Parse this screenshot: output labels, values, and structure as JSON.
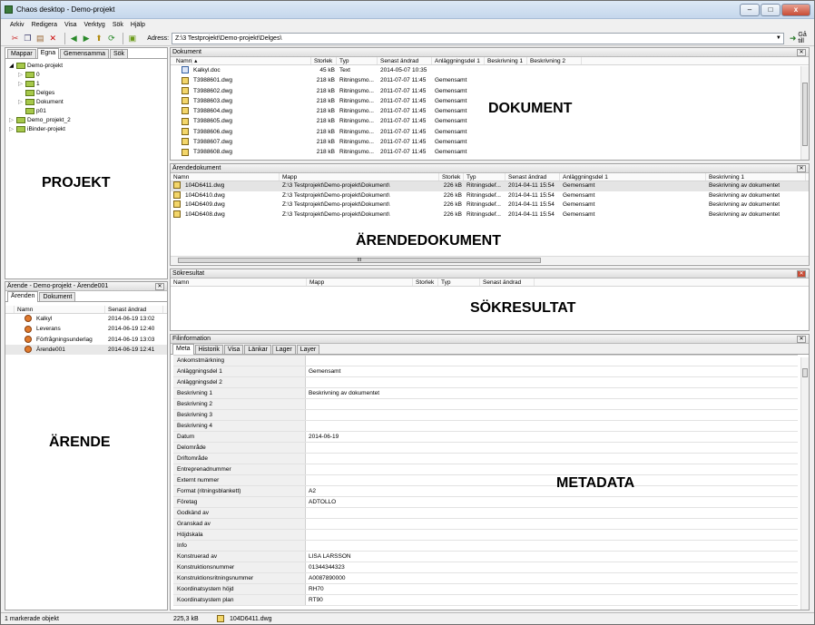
{
  "window": {
    "title": "Chaos desktop - Demo-projekt",
    "min": "–",
    "max": "□",
    "close": "x"
  },
  "menu": [
    "Arkiv",
    "Redigera",
    "Visa",
    "Verktyg",
    "Sök",
    "Hjälp"
  ],
  "toolbar": {
    "address_label": "Adress:",
    "address_value": "Z:\\3 Testprojekt\\Demo-projekt\\Delges\\",
    "goto_label": "Gå till"
  },
  "projects": {
    "tabs": [
      "Mappar",
      "Egna",
      "Gemensamma",
      "Sök"
    ],
    "active_tab": "Egna",
    "tree": [
      {
        "label": "Demo-projekt",
        "level": 0,
        "expander": "◢"
      },
      {
        "label": "0",
        "level": 1,
        "expander": "▷"
      },
      {
        "label": "1",
        "level": 1,
        "expander": "▷"
      },
      {
        "label": "Delges",
        "level": 1,
        "expander": ""
      },
      {
        "label": "Dokument",
        "level": 1,
        "expander": "▷"
      },
      {
        "label": "p01",
        "level": 1,
        "expander": ""
      },
      {
        "label": "Demo_projekt_2",
        "level": 0,
        "expander": "▷"
      },
      {
        "label": "iBinder-projekt",
        "level": 0,
        "expander": "▷"
      }
    ],
    "overlay": "PROJEKT"
  },
  "documents": {
    "title": "Dokument",
    "columns": [
      "Namn",
      "Storlek",
      "Typ",
      "Senast ändrad",
      "Anläggningsdel 1",
      "Beskrivning 1",
      "Beskrivning 2"
    ],
    "rows": [
      {
        "icon": "doc",
        "name": "Kalkyl.doc",
        "size": "45 kB",
        "type": "Text",
        "date": "2014-05-07 10:35",
        "part": ""
      },
      {
        "icon": "dwg",
        "name": "T3988601.dwg",
        "size": "218 kB",
        "type": "Ritningsmo...",
        "date": "2011-07-07 11:45",
        "part": "Gemensamt"
      },
      {
        "icon": "dwg",
        "name": "T3988602.dwg",
        "size": "218 kB",
        "type": "Ritningsmo...",
        "date": "2011-07-07 11:45",
        "part": "Gemensamt"
      },
      {
        "icon": "dwg",
        "name": "T3988603.dwg",
        "size": "218 kB",
        "type": "Ritningsmo...",
        "date": "2011-07-07 11:45",
        "part": "Gemensamt"
      },
      {
        "icon": "dwg",
        "name": "T3988604.dwg",
        "size": "218 kB",
        "type": "Ritningsmo...",
        "date": "2011-07-07 11:45",
        "part": "Gemensamt"
      },
      {
        "icon": "dwg",
        "name": "T3988605.dwg",
        "size": "218 kB",
        "type": "Ritningsmo...",
        "date": "2011-07-07 11:45",
        "part": "Gemensamt"
      },
      {
        "icon": "dwg",
        "name": "T3988606.dwg",
        "size": "218 kB",
        "type": "Ritningsmo...",
        "date": "2011-07-07 11:45",
        "part": "Gemensamt"
      },
      {
        "icon": "dwg",
        "name": "T3988607.dwg",
        "size": "218 kB",
        "type": "Ritningsmo...",
        "date": "2011-07-07 11:45",
        "part": "Gemensamt"
      },
      {
        "icon": "dwg",
        "name": "T3988608.dwg",
        "size": "218 kB",
        "type": "Ritningsmo...",
        "date": "2011-07-07 11:45",
        "part": "Gemensamt"
      }
    ],
    "overlay": "DOKUMENT"
  },
  "case_documents": {
    "title": "Ärendedokument",
    "columns": [
      "Namn",
      "Mapp",
      "Storlek",
      "Typ",
      "Senast ändrad",
      "Anläggningsdel 1",
      "Beskrivning 1"
    ],
    "rows": [
      {
        "name": "104D6411.dwg",
        "folder": "Z:\\3 Testprojekt\\Demo-projekt\\Dokument\\",
        "size": "226 kB",
        "type": "Ritningsdef...",
        "date": "2014-04-11 15:54",
        "part": "Gemensamt",
        "desc": "Beskrivning av dokumentet"
      },
      {
        "name": "104D6410.dwg",
        "folder": "Z:\\3 Testprojekt\\Demo-projekt\\Dokument\\",
        "size": "226 kB",
        "type": "Ritningsdef...",
        "date": "2014-04-11 15:54",
        "part": "Gemensamt",
        "desc": "Beskrivning av dokumentet"
      },
      {
        "name": "104D6409.dwg",
        "folder": "Z:\\3 Testprojekt\\Demo-projekt\\Dokument\\",
        "size": "226 kB",
        "type": "Ritningsdef...",
        "date": "2014-04-11 15:54",
        "part": "Gemensamt",
        "desc": "Beskrivning av dokumentet"
      },
      {
        "name": "104D6408.dwg",
        "folder": "Z:\\3 Testprojekt\\Demo-projekt\\Dokument\\",
        "size": "226 kB",
        "type": "Ritningsdef...",
        "date": "2014-04-11 15:54",
        "part": "Gemensamt",
        "desc": "Beskrivning av dokumentet"
      }
    ],
    "scroll_grip": "III",
    "overlay": "ÄRENDEDOKUMENT"
  },
  "search": {
    "title": "Sökresultat",
    "columns": [
      "Namn",
      "Mapp",
      "Storlek",
      "Typ",
      "Senast ändrad"
    ],
    "overlay": "SÖKRESULTAT"
  },
  "cases": {
    "title": "Ärende - Demo-projekt - Ärende001",
    "tabs": [
      "Ärenden",
      "Dokument"
    ],
    "active_tab": "Ärenden",
    "columns": [
      "Namn",
      "Senast ändrad"
    ],
    "rows": [
      {
        "name": "Kalkyl",
        "date": "2014-06-19 13:02"
      },
      {
        "name": "Leverans",
        "date": "2014-06-19 12:40"
      },
      {
        "name": "Förfrågningsunderlag",
        "date": "2014-06-19 13:03"
      },
      {
        "name": "Ärende001",
        "date": "2014-06-19 12:41"
      }
    ],
    "overlay": "ÄRENDE"
  },
  "fileinfo": {
    "title": "Filinformation",
    "tabs": [
      "Meta",
      "Historik",
      "Visa",
      "Länkar",
      "Lager",
      "Layer"
    ],
    "active_tab": "Meta",
    "rows": [
      {
        "k": "Ankomstmärkning",
        "v": ""
      },
      {
        "k": "Anläggningsdel 1",
        "v": "Gemensamt"
      },
      {
        "k": "Anläggningsdel 2",
        "v": ""
      },
      {
        "k": "Beskrivning 1",
        "v": "Beskrivning av dokumentet"
      },
      {
        "k": "Beskrivning 2",
        "v": ""
      },
      {
        "k": "Beskrivning 3",
        "v": ""
      },
      {
        "k": "Beskrivning 4",
        "v": ""
      },
      {
        "k": "Datum",
        "v": "2014-06-19"
      },
      {
        "k": "Delområde",
        "v": ""
      },
      {
        "k": "Driftområde",
        "v": ""
      },
      {
        "k": "Entreprenadnummer",
        "v": ""
      },
      {
        "k": "Externt nummer",
        "v": ""
      },
      {
        "k": "Format (ritningsblankett)",
        "v": "A2"
      },
      {
        "k": "Företag",
        "v": "ADTOLLO"
      },
      {
        "k": "Godkänd av",
        "v": ""
      },
      {
        "k": "Granskad av",
        "v": ""
      },
      {
        "k": "Höjdskala",
        "v": ""
      },
      {
        "k": "Info",
        "v": ""
      },
      {
        "k": "Konstruerad av",
        "v": "LISA LARSSON"
      },
      {
        "k": "Konstruktionsnummer",
        "v": "01344344323"
      },
      {
        "k": "Konstruktionsritningsnummer",
        "v": "A0087890000"
      },
      {
        "k": "Koordinatsystem höjd",
        "v": "RH70"
      },
      {
        "k": "Koordinatsystem plan",
        "v": "RT90"
      }
    ],
    "overlay": "METADATA"
  },
  "status": {
    "selected": "1 markerade objekt",
    "size": "225,3 kB",
    "file": "104D6411.dwg"
  }
}
